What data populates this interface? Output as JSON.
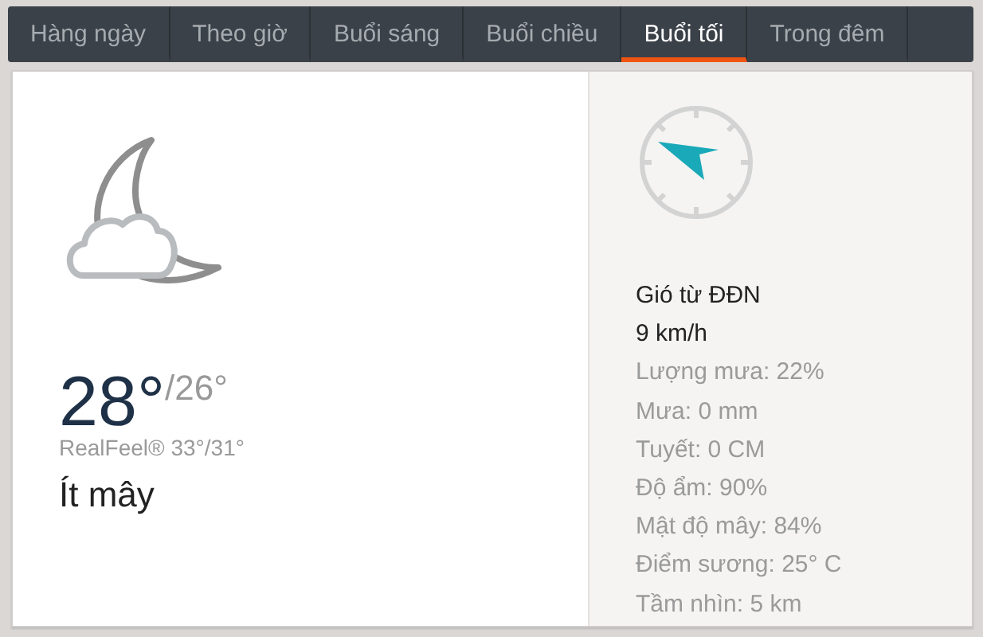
{
  "tabs": [
    {
      "label": "Hàng ngày",
      "selected": false
    },
    {
      "label": "Theo giờ",
      "selected": false
    },
    {
      "label": "Buổi sáng",
      "selected": false
    },
    {
      "label": "Buổi chiều",
      "selected": false
    },
    {
      "label": "Buổi tối",
      "selected": true
    },
    {
      "label": "Trong đêm",
      "selected": false
    }
  ],
  "current": {
    "temp": "28°",
    "low": "/26°",
    "realfeel": "RealFeel® 33°/31°",
    "condition": "Ít mây"
  },
  "details": [
    {
      "kind": "primary",
      "text": "Gió từ ĐĐN"
    },
    {
      "kind": "primary",
      "text": "9 km/h"
    },
    {
      "kind": "secondary",
      "text": "Lượng mưa: 22%"
    },
    {
      "kind": "secondary",
      "text": "Mưa: 0 mm"
    },
    {
      "kind": "secondary",
      "text": "Tuyết: 0 CM"
    },
    {
      "kind": "secondary",
      "text": "Độ ẩm: 90%"
    },
    {
      "kind": "secondary",
      "text": "Mật độ mây: 84%"
    },
    {
      "kind": "secondary",
      "text": "Điểm sương: 25° C"
    },
    {
      "kind": "secondary",
      "text": "Tầm nhìn: 5 km"
    }
  ]
}
